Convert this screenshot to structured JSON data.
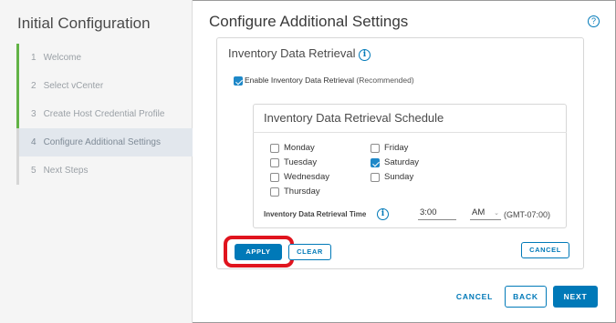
{
  "wizard": {
    "title": "Initial Configuration",
    "steps": [
      {
        "num": "1",
        "label": "Welcome",
        "status": "done"
      },
      {
        "num": "2",
        "label": "Select vCenter",
        "status": "done"
      },
      {
        "num": "3",
        "label": "Create Host Credential Profile",
        "status": "done"
      },
      {
        "num": "4",
        "label": "Configure Additional Settings",
        "status": "active"
      },
      {
        "num": "5",
        "label": "Next Steps",
        "status": "pending"
      }
    ]
  },
  "main": {
    "title": "Configure Additional Settings",
    "help_glyph": "?"
  },
  "retrieval": {
    "title": "Inventory Data Retrieval",
    "info_glyph": "i",
    "enable_label": "Enable Inventory Data Retrieval",
    "enable_note": "(Recommended)",
    "enabled": true
  },
  "schedule": {
    "title": "Inventory Data Retrieval Schedule",
    "days": {
      "monday": {
        "label": "Monday",
        "checked": false
      },
      "tuesday": {
        "label": "Tuesday",
        "checked": false
      },
      "wednesday": {
        "label": "Wednesday",
        "checked": false
      },
      "thursday": {
        "label": "Thursday",
        "checked": false
      },
      "friday": {
        "label": "Friday",
        "checked": false
      },
      "saturday": {
        "label": "Saturday",
        "checked": true
      },
      "sunday": {
        "label": "Sunday",
        "checked": false
      }
    },
    "time_label": "Inventory Data Retrieval Time",
    "time_value": "3:00",
    "ampm_value": "AM",
    "timezone": "(GMT-07:00)",
    "apply_label": "APPLY",
    "clear_label": "CLEAR",
    "cancel_label": "CANCEL"
  },
  "footer": {
    "cancel_label": "CANCEL",
    "back_label": "BACK",
    "next_label": "NEXT"
  },
  "colors": {
    "accent": "#0079b8",
    "step_done": "#62b346",
    "highlight": "#e0141e"
  }
}
